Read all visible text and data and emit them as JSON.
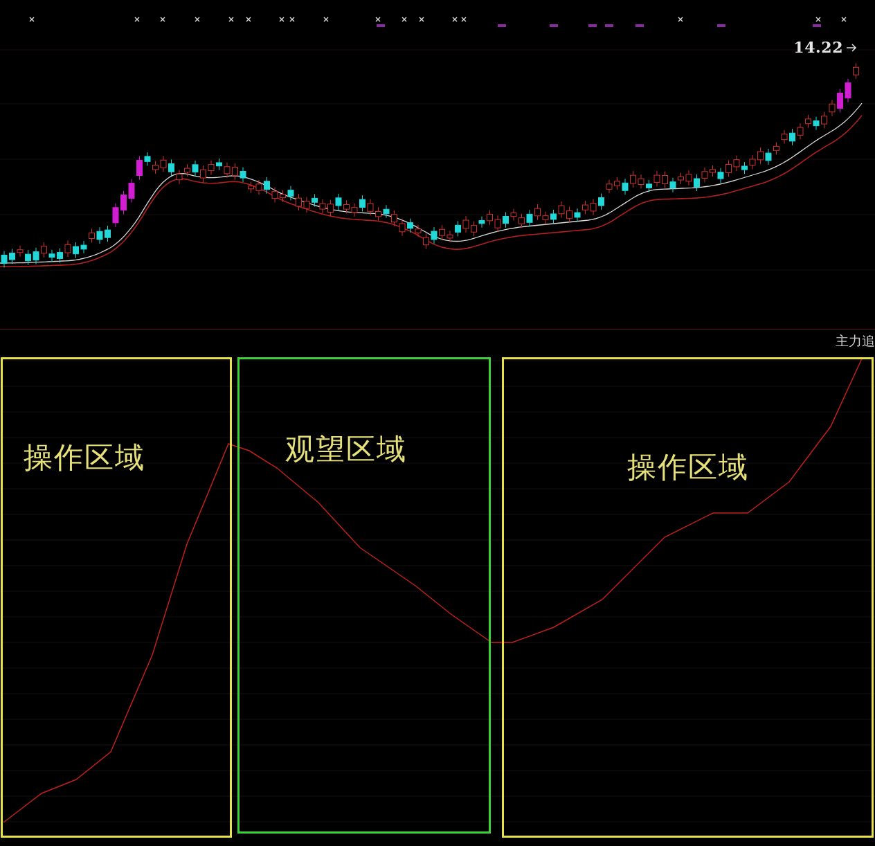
{
  "price_chart": {
    "last_price": "14.22"
  },
  "indicator_panel": {
    "title": "主力追",
    "zones": [
      {
        "label": "操作区域",
        "color": "#e8e24a"
      },
      {
        "label": "观望区域",
        "color": "#3fd13a"
      },
      {
        "label": "操作区域",
        "color": "#e8e24a"
      }
    ]
  }
}
